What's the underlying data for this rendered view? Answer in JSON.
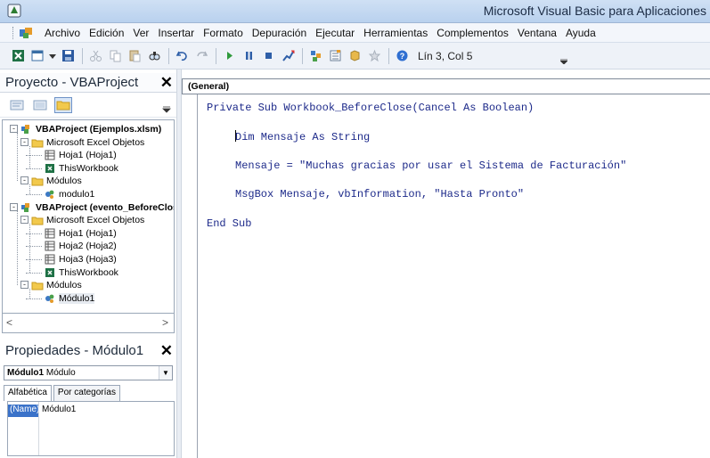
{
  "window": {
    "title": "Microsoft Visual Basic para Aplicaciones",
    "app_icon": "excel-vba-app-icon"
  },
  "menu": {
    "items": [
      "Archivo",
      "Edición",
      "Ver",
      "Insertar",
      "Formato",
      "Depuración",
      "Ejecutar",
      "Herramientas",
      "Complementos",
      "Ventana",
      "Ayuda"
    ]
  },
  "toolbar": {
    "icons": [
      "excel-icon",
      "insert-module-icon",
      "save-icon",
      "cut-icon",
      "copy-icon",
      "paste-icon",
      "find-icon",
      "undo-icon",
      "redo-icon",
      "run-icon",
      "break-icon",
      "reset-icon",
      "design-mode-icon",
      "project-explorer-icon",
      "properties-icon",
      "object-browser-icon",
      "toolbox-icon",
      "help-icon"
    ],
    "status": "Lín 3, Col 5"
  },
  "project": {
    "title": "Proyecto - VBAProject",
    "tree": [
      {
        "label": "VBAProject (Ejemplos.xlsm)",
        "level": 0,
        "bold": true,
        "icon": "vba-project-icon",
        "box": "-"
      },
      {
        "label": "Microsoft Excel Objetos",
        "level": 1,
        "icon": "folder-icon",
        "box": "-"
      },
      {
        "label": "Hoja1 (Hoja1)",
        "level": 2,
        "icon": "sheet-icon"
      },
      {
        "label": "ThisWorkbook",
        "level": 2,
        "icon": "workbook-icon"
      },
      {
        "label": "Módulos",
        "level": 1,
        "icon": "folder-icon",
        "box": "-"
      },
      {
        "label": "modulo1",
        "level": 2,
        "icon": "module-icon"
      },
      {
        "label": "VBAProject (evento_BeforeClose.xlsm)",
        "level": 0,
        "bold": true,
        "icon": "vba-project-icon",
        "box": "-"
      },
      {
        "label": "Microsoft Excel Objetos",
        "level": 1,
        "icon": "folder-icon",
        "box": "-"
      },
      {
        "label": "Hoja1 (Hoja1)",
        "level": 2,
        "icon": "sheet-icon"
      },
      {
        "label": "Hoja2 (Hoja2)",
        "level": 2,
        "icon": "sheet-icon"
      },
      {
        "label": "Hoja3 (Hoja3)",
        "level": 2,
        "icon": "sheet-icon"
      },
      {
        "label": "ThisWorkbook",
        "level": 2,
        "icon": "workbook-icon"
      },
      {
        "label": "Módulos",
        "level": 1,
        "icon": "folder-icon",
        "box": "-"
      },
      {
        "label": "Módulo1",
        "level": 2,
        "icon": "module-icon",
        "selected": true
      }
    ]
  },
  "properties": {
    "title": "Propiedades - Módulo1",
    "object_name": "Módulo1",
    "object_type": "Módulo",
    "tabs": [
      "Alfabética",
      "Por categorías"
    ],
    "rows": [
      {
        "name": "(Name)",
        "value": "Módulo1"
      }
    ]
  },
  "code": {
    "object_combo": "(General)",
    "lines": [
      {
        "parts": [
          {
            "t": "Private Sub Workbook_BeforeClose(Cancel As Boolean)",
            "c": "kw"
          }
        ]
      },
      {
        "parts": [
          {
            "t": "Dim Mensaje As String",
            "c": "kw"
          }
        ],
        "caret": true
      },
      {
        "parts": [
          {
            "t": "Mensaje = \"Muchas gracias por usar el Sistema de Facturación\"",
            "c": "kw"
          }
        ]
      },
      {
        "parts": [
          {
            "t": "MsgBox Mensaje, vbInformation, \"Hasta Pronto\"",
            "c": "kw"
          }
        ]
      },
      {
        "parts": [
          {
            "t": "End Sub",
            "c": "kw"
          }
        ]
      }
    ]
  }
}
